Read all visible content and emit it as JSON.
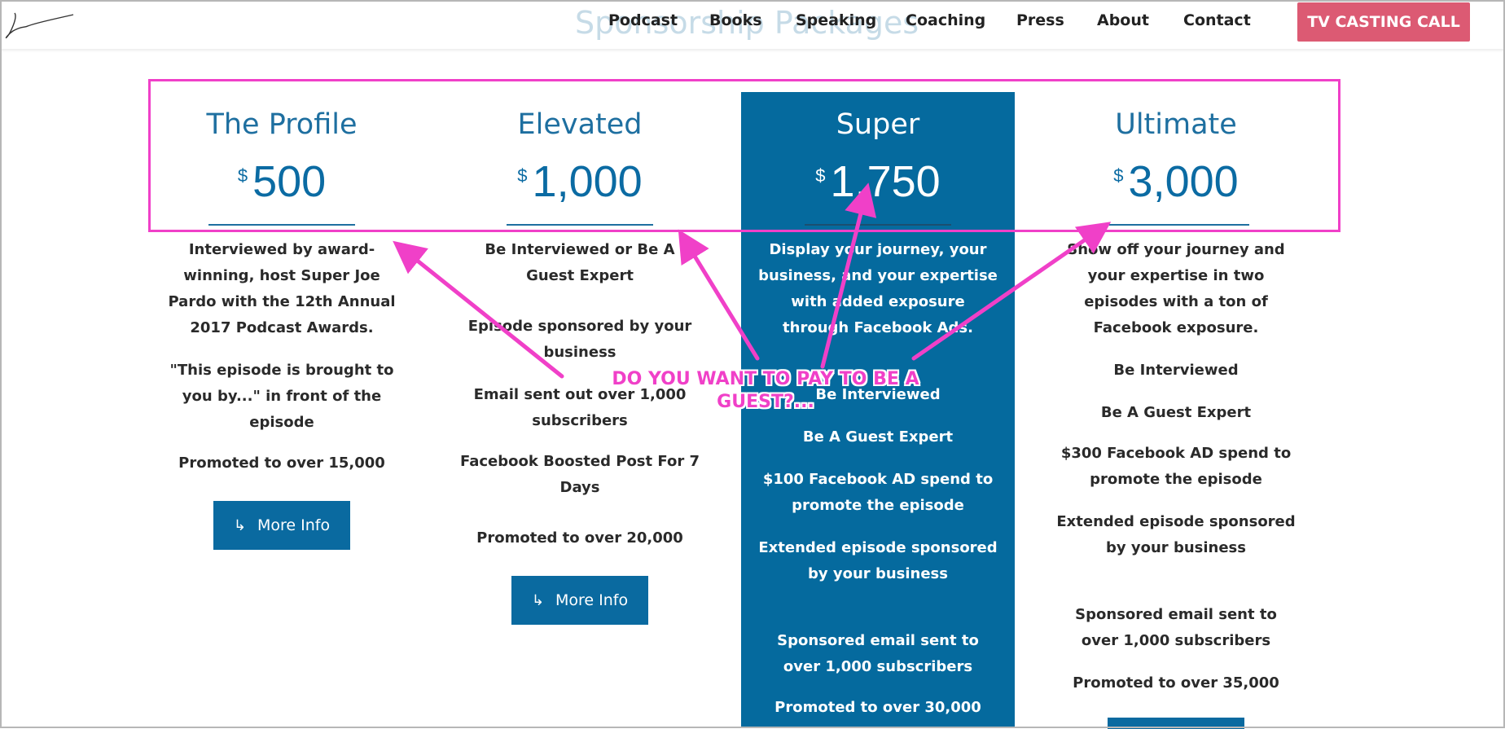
{
  "header": {
    "ghost_title": "Sponsorship Packages",
    "nav": [
      "Podcast",
      "Books",
      "Speaking",
      "Coaching",
      "Press",
      "About",
      "Contact"
    ],
    "cta_label": "TV CASTING CALL",
    "cta_color": "#dc5a73"
  },
  "plans": [
    {
      "name": "The Profile",
      "currency": "$",
      "price": "500",
      "features": [
        "Interviewed by award-winning, host Super Joe Pardo with the 12th Annual 2017 Podcast Awards.",
        "\"This episode is brought to you by...\" in front of the episode",
        "Promoted to over 15,000"
      ],
      "button": "More Info"
    },
    {
      "name": "Elevated",
      "currency": "$",
      "price": "1,000",
      "features": [
        "Be Interviewed or Be A Guest Expert",
        "Episode sponsored by your business",
        "Email sent out over 1,000 subscribers",
        "Facebook Boosted Post For 7 Days",
        "Promoted to over 20,000"
      ],
      "button": "More Info"
    },
    {
      "name": "Super",
      "currency": "$",
      "price": "1,750",
      "features": [
        "Display your journey, your business, and your expertise with added exposure through Facebook Ads.",
        "Be Interviewed",
        "Be A Guest Expert",
        "$100 Facebook AD spend to promote the episode",
        "Extended episode sponsored by your business",
        "Sponsored email sent to over 1,000 subscribers",
        "Promoted to over 30,000"
      ]
    },
    {
      "name": "Ultimate",
      "currency": "$",
      "price": "3,000",
      "features": [
        "Show off your journey and your expertise in two episodes with a ton of Facebook exposure.",
        "Be Interviewed",
        "Be A Guest Expert",
        "$300 Facebook AD spend to promote the episode",
        "Extended episode sponsored by your business",
        "Sponsored email sent to over 1,000 subscribers",
        "Promoted to over 35,000"
      ]
    }
  ],
  "annotation": {
    "line1": "DO YOU WANT TO PAY TO BE A",
    "line2": "GUEST?...",
    "color": "#f040c8"
  },
  "colors": {
    "primary": "#056a9e",
    "heading": "#1e6fa0"
  }
}
